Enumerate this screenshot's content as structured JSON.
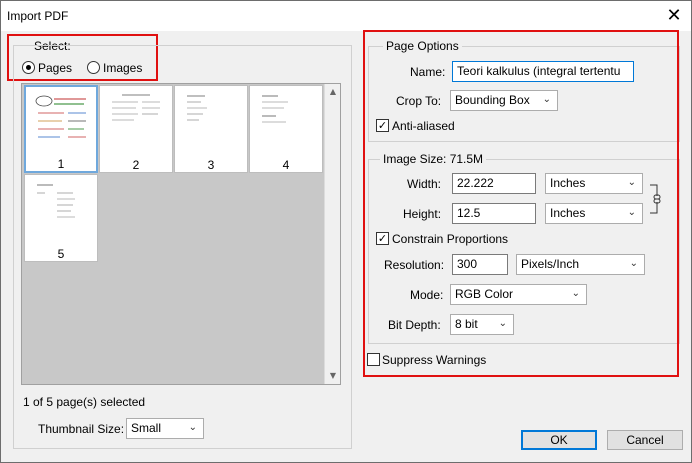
{
  "window": {
    "title": "Import PDF",
    "close_glyph": "✕"
  },
  "select": {
    "legend": "Select:",
    "pages_label": "Pages",
    "images_label": "Images",
    "selected": "Pages"
  },
  "thumbnails": {
    "pages": [
      "1",
      "2",
      "3",
      "4",
      "5"
    ],
    "selected_index": 0,
    "status": "1 of 5 page(s) selected",
    "size_label": "Thumbnail Size:",
    "size_value": "Small"
  },
  "page_options": {
    "legend": "Page Options",
    "name_label": "Name:",
    "name_value": "Teori kalkulus (integral tertentu",
    "crop_label": "Crop To:",
    "crop_value": "Bounding Box",
    "antialias_label": "Anti-aliased",
    "antialias_checked": true
  },
  "image_size": {
    "legend": "Image Size: 71.5M",
    "width_label": "Width:",
    "width_value": "22.222",
    "width_unit": "Inches",
    "height_label": "Height:",
    "height_value": "12.5",
    "height_unit": "Inches",
    "constrain_label": "Constrain Proportions",
    "constrain_checked": true,
    "resolution_label": "Resolution:",
    "resolution_value": "300",
    "resolution_unit": "Pixels/Inch",
    "mode_label": "Mode:",
    "mode_value": "RGB Color",
    "bitdepth_label": "Bit Depth:",
    "bitdepth_value": "8 bit"
  },
  "suppress_label": "Suppress Warnings",
  "suppress_checked": false,
  "buttons": {
    "ok": "OK",
    "cancel": "Cancel"
  },
  "icons": {
    "close": "close-icon",
    "dropdown": "chevron-down-icon",
    "check": "checkmark-icon",
    "link": "chain-link-icon",
    "scroll_up": "arrow-up-icon",
    "scroll_down": "arrow-down-icon"
  },
  "glyphs": {
    "chevron": "⌄",
    "check": "✓",
    "up": "▲",
    "down": "▼"
  },
  "colors": {
    "highlight_box": "#e01010",
    "selection_border": "#6fa8dc",
    "focus_border": "#0078d7"
  }
}
